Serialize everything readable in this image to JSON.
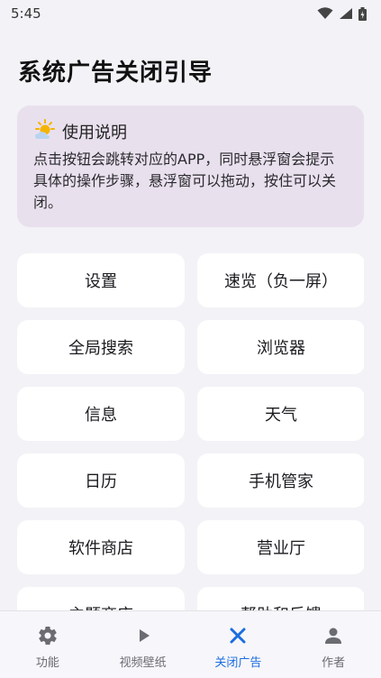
{
  "status_bar": {
    "time": "5:45"
  },
  "page": {
    "title": "系统广告关闭引导"
  },
  "info": {
    "title": "使用说明",
    "icon": "weather-sun-cloud-icon",
    "text": "点击按钮会跳转对应的APP，同时悬浮窗会提示具体的操作步骤，悬浮窗可以拖动，按住可以关闭。"
  },
  "tiles": [
    {
      "label": "设置"
    },
    {
      "label": "速览（负一屏）"
    },
    {
      "label": "全局搜索"
    },
    {
      "label": "浏览器"
    },
    {
      "label": "信息"
    },
    {
      "label": "天气"
    },
    {
      "label": "日历"
    },
    {
      "label": "手机管家"
    },
    {
      "label": "软件商店"
    },
    {
      "label": "营业厅"
    },
    {
      "label": "主题商店"
    },
    {
      "label": "帮助和反馈"
    }
  ],
  "bottom_nav": [
    {
      "label": "功能",
      "icon": "gear-icon",
      "active": false
    },
    {
      "label": "视频壁纸",
      "icon": "play-icon",
      "active": false
    },
    {
      "label": "关闭广告",
      "icon": "close-icon",
      "active": true
    },
    {
      "label": "作者",
      "icon": "person-icon",
      "active": false
    }
  ],
  "colors": {
    "accent": "#1a6ee0",
    "background": "#f3f2f7",
    "card": "#e9e0ee",
    "tile": "#ffffff"
  }
}
